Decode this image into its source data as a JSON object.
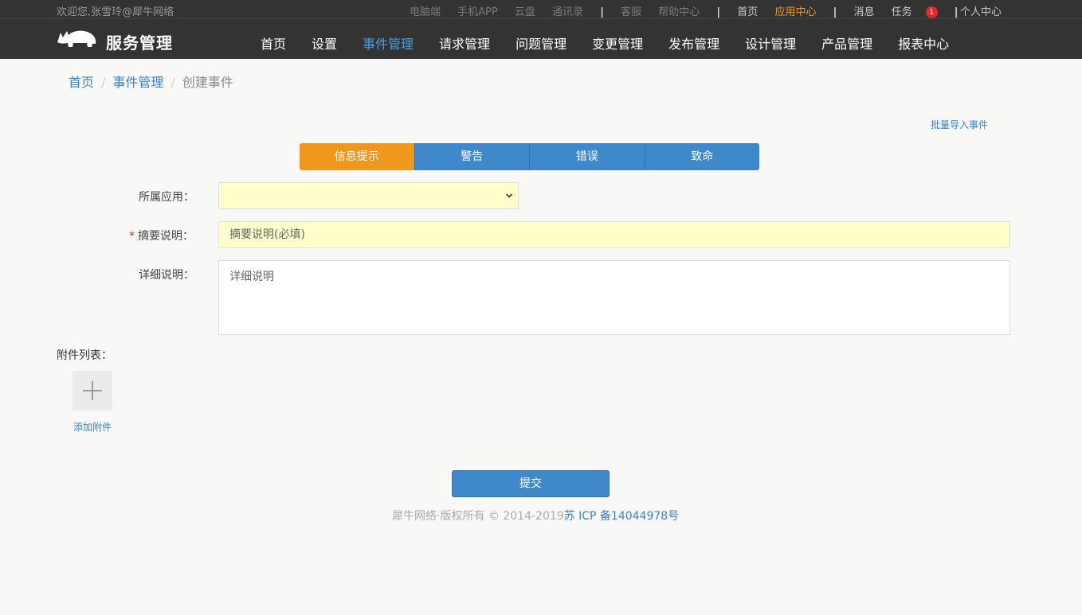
{
  "header": {
    "welcome": "欢迎您,张雪玲@犀牛网络",
    "links": {
      "desktop": "电脑端",
      "mobile_app": "手机APP",
      "cloud": "云盘",
      "contacts": "通讯录",
      "service": "客服",
      "help": "帮助中心",
      "home": "首页",
      "app_center": "应用中心",
      "messages": "消息",
      "tasks": "任务",
      "tasks_count": "1",
      "personal": "个人中心"
    },
    "logo_text": "服务管理",
    "nav": [
      "首页",
      "设置",
      "事件管理",
      "请求管理",
      "问题管理",
      "变更管理",
      "发布管理",
      "设计管理",
      "产品管理",
      "报表中心"
    ],
    "active_nav": "事件管理"
  },
  "breadcrumb": {
    "home": "首页",
    "section": "事件管理",
    "current": "创建事件"
  },
  "batch_import": "批量导入事件",
  "levels": [
    "信息提示",
    "警告",
    "错误",
    "致命"
  ],
  "active_level": "信息提示",
  "form": {
    "app_label": "所属应用：",
    "app_value": "",
    "summary_label": "摘要说明：",
    "summary_required_mark": "*",
    "summary_placeholder": "摘要说明(必填)",
    "detail_label": "详细说明：",
    "detail_placeholder": "详细说明"
  },
  "attachments": {
    "label": "附件列表：",
    "add_text": "添加附件"
  },
  "submit": "提交",
  "footer": {
    "copyright": "犀牛网络·版权所有 © 2014-2019",
    "icp": "苏 ICP 备14044978号"
  },
  "colors": {
    "topbar": "#333333",
    "primary": "#3f88c9",
    "accent": "#f0981e",
    "link": "#3a82c4",
    "input_highlight": "#ffffcc",
    "badge": "#e02b2b"
  }
}
